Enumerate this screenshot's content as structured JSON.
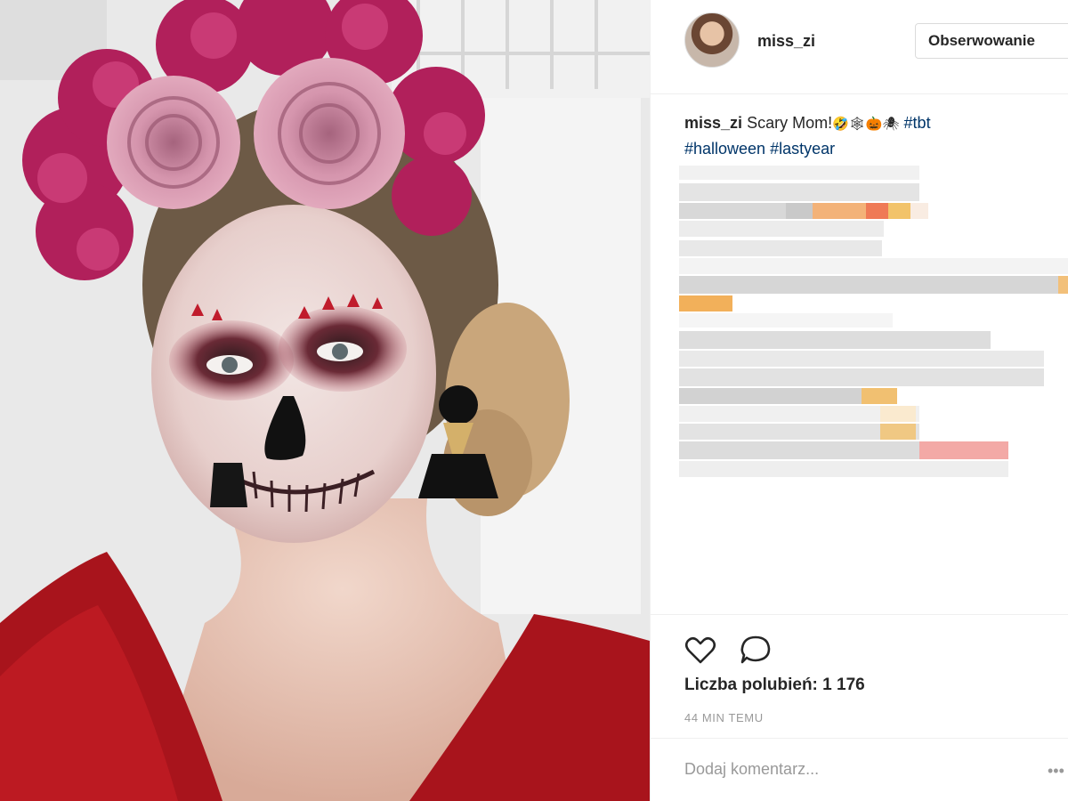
{
  "post": {
    "username": "miss_zi",
    "follow_label": "Obserwowanie",
    "caption": {
      "username": "miss_zi",
      "text": "Scary Mom!",
      "emojis": "🤣🕸🎃🕷",
      "hashtag_tbt": "#tbt",
      "hashtag_halloween": "#halloween",
      "hashtag_lastyear": "#lastyear"
    },
    "likes_text": "Liczba polubień: 1 176",
    "timestamp": "44 MIN TEMU",
    "comment_placeholder": "Dodaj komentarz..."
  },
  "icons": {
    "like": "heart-icon",
    "comment": "speech-bubble-icon",
    "more": "more-options-icon"
  },
  "colors": {
    "hashtag": "#003569",
    "text": "#262626",
    "muted": "#999999",
    "border": "#efefef"
  }
}
